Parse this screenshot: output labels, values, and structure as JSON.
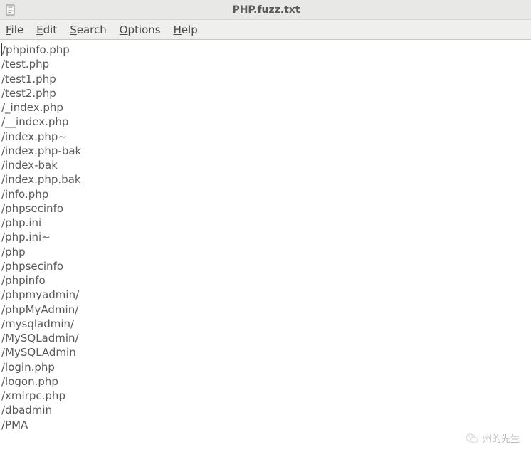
{
  "titlebar": {
    "title": "PHP.fuzz.txt"
  },
  "menubar": {
    "items": [
      {
        "label": "File",
        "underline_index": 0
      },
      {
        "label": "Edit",
        "underline_index": 0
      },
      {
        "label": "Search",
        "underline_index": 0
      },
      {
        "label": "Options",
        "underline_index": 0
      },
      {
        "label": "Help",
        "underline_index": 0
      }
    ]
  },
  "content": {
    "lines": [
      "/phpinfo.php",
      "/test.php",
      "/test1.php",
      "/test2.php",
      "/_index.php",
      "/__index.php",
      "/index.php~",
      "/index.php-bak",
      "/index-bak",
      "/index.php.bak",
      "/info.php",
      "/phpsecinfo",
      "/php.ini",
      "/php.ini~",
      "/php",
      "/phpsecinfo",
      "/phpinfo",
      "/phpmyadmin/",
      "/phpMyAdmin/",
      "/mysqladmin/",
      "/MySQLadmin/",
      "/MySQLAdmin",
      "/login.php",
      "/logon.php",
      "/xmlrpc.php",
      "/dbadmin",
      "/PMA"
    ]
  },
  "watermark": {
    "text": "州的先生"
  }
}
